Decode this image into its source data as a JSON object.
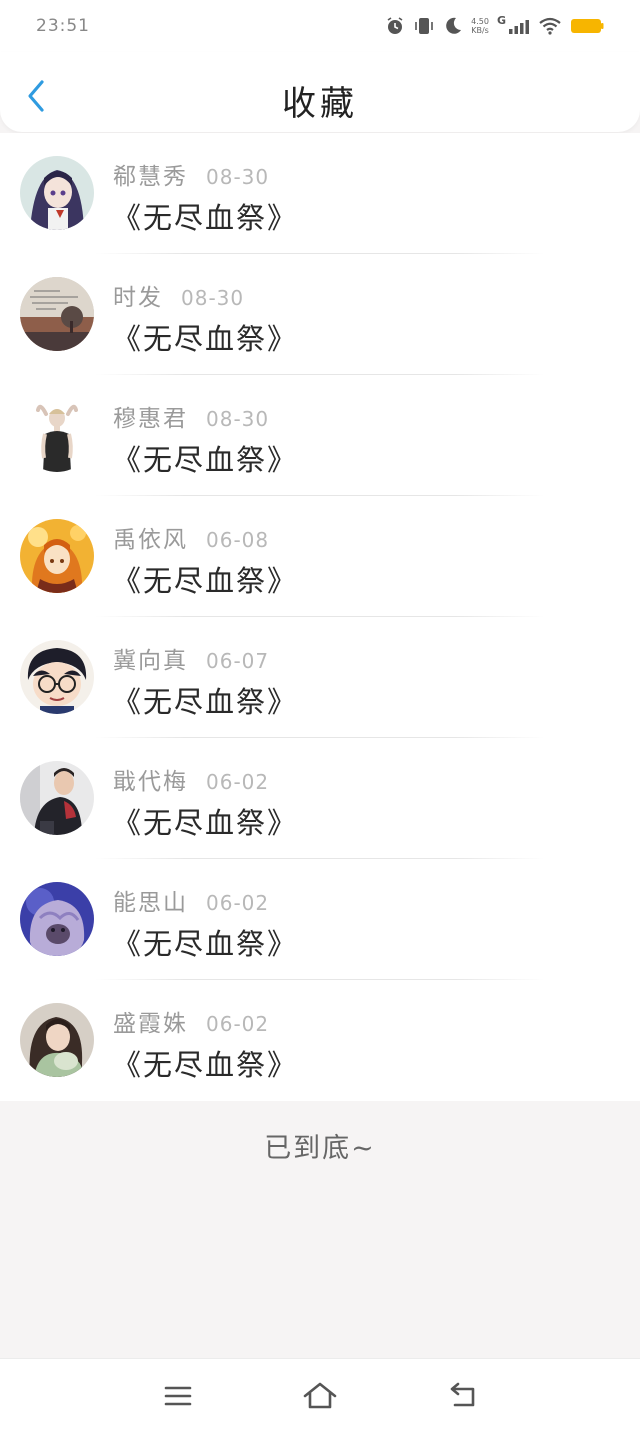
{
  "status_bar": {
    "time": "23:51",
    "net_speed_value": "4.50",
    "net_speed_unit": "KB/s",
    "network_type": "G",
    "icons": [
      "alarm-icon",
      "vibrate-icon",
      "moon-icon",
      "signal-icon",
      "wifi-icon",
      "battery-icon"
    ],
    "battery_color": "#f7b500"
  },
  "header": {
    "back_icon": "chevron-left-icon",
    "title": "收藏"
  },
  "accent_color": "#2f9be0",
  "items": [
    {
      "name": "郗慧秀",
      "date": "08-30",
      "title": "《无尽血祭》",
      "avatar": "anime-girl-purple"
    },
    {
      "name": "时发",
      "date": "08-30",
      "title": "《无尽血祭》",
      "avatar": "sunset-tree-text"
    },
    {
      "name": "穆惠君",
      "date": "08-30",
      "title": "《无尽血祭》",
      "avatar": "woman-black-tank"
    },
    {
      "name": "禹依风",
      "date": "06-08",
      "title": "《无尽血祭》",
      "avatar": "anime-girl-golden"
    },
    {
      "name": "冀向真",
      "date": "06-07",
      "title": "《无尽血祭》",
      "avatar": "boy-glasses-cartoon"
    },
    {
      "name": "戢代梅",
      "date": "06-02",
      "title": "《无尽血祭》",
      "avatar": "man-dark-jacket"
    },
    {
      "name": "能思山",
      "date": "06-02",
      "title": "《无尽血祭》",
      "avatar": "purple-fluffy-animal"
    },
    {
      "name": "盛霞姝",
      "date": "06-02",
      "title": "《无尽血祭》",
      "avatar": "girl-holding-plush"
    }
  ],
  "footer": {
    "end_text": "已到底~"
  },
  "nav_bar": {
    "icons": [
      "menu-icon",
      "home-icon",
      "back-icon"
    ]
  }
}
